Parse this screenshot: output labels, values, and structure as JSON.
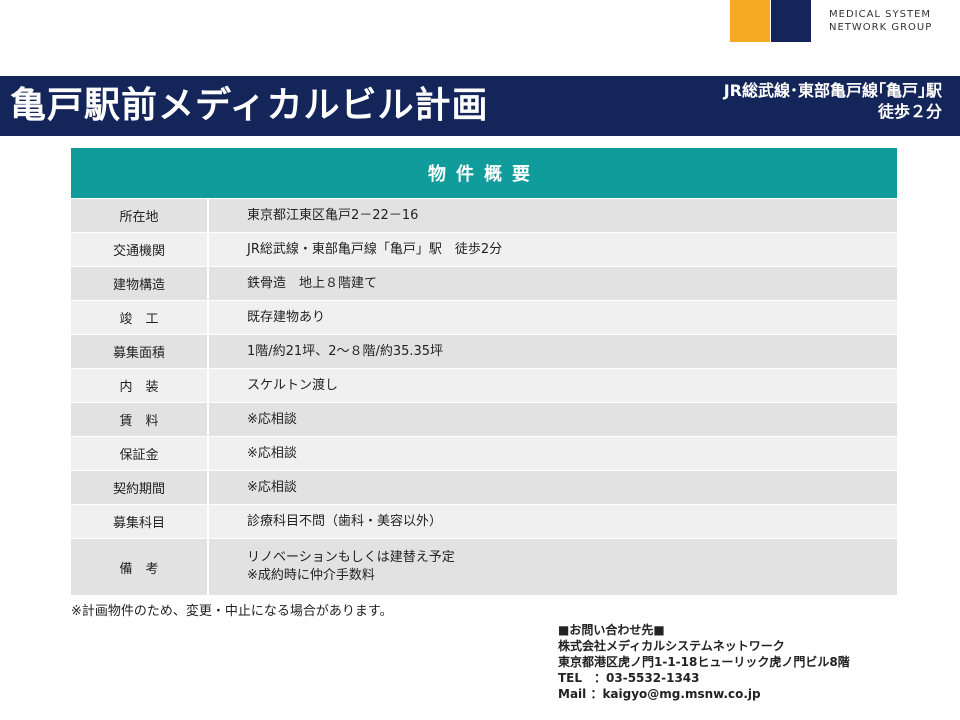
{
  "logo": {
    "brand_colors": [
      "#f6a923",
      "#14255a"
    ],
    "text": "MEDICAL SYSTEM\nNETWORK GROUP"
  },
  "header": {
    "title": "亀戸駅前メディカルビル計画",
    "access_line1": "JR総武線･東部亀戸線｢亀戸｣駅",
    "access_line2": "徒歩２分"
  },
  "table": {
    "heading": "物件概要",
    "rows": [
      {
        "label": "所在地",
        "value": [
          "東京都江東区亀戸2－22－16"
        ]
      },
      {
        "label": "交通機関",
        "value": [
          "JR総武線・東部亀戸線「亀戸」駅　徒歩2分"
        ]
      },
      {
        "label": "建物構造",
        "value": [
          "鉄骨造　地上８階建て"
        ]
      },
      {
        "label": "竣　工",
        "value": [
          "既存建物あり"
        ]
      },
      {
        "label": "募集面積",
        "value": [
          "1階/約21坪、2～８階/約35.35坪"
        ]
      },
      {
        "label": "内　装",
        "value": [
          "スケルトン渡し"
        ]
      },
      {
        "label": "賃　料",
        "value": [
          "※応相談"
        ]
      },
      {
        "label": "保証金",
        "value": [
          "※応相談"
        ]
      },
      {
        "label": "契約期間",
        "value": [
          "※応相談"
        ]
      },
      {
        "label": "募集科目",
        "value": [
          "診療科目不問（歯科・美容以外）"
        ]
      },
      {
        "label": "備　考",
        "value": [
          "リノベーションもしくは建替え予定",
          "※成約時に仲介手数料"
        ]
      }
    ]
  },
  "note": "※計画物件のため、変更・中止になる場合があります。",
  "contact": {
    "heading": "■お問い合わせ先■",
    "company": "株式会社メディカルシステムネットワーク",
    "address": "東京都港区虎ノ門1-1-18ヒューリック虎ノ門ビル8階",
    "tel": "TEL　：03-5532-1343",
    "mail": "Mail ：kaigyo@mg.msnw.co.jp"
  },
  "colors": {
    "navy": "#14255a",
    "teal": "#109c9a",
    "orange": "#f6a923"
  }
}
